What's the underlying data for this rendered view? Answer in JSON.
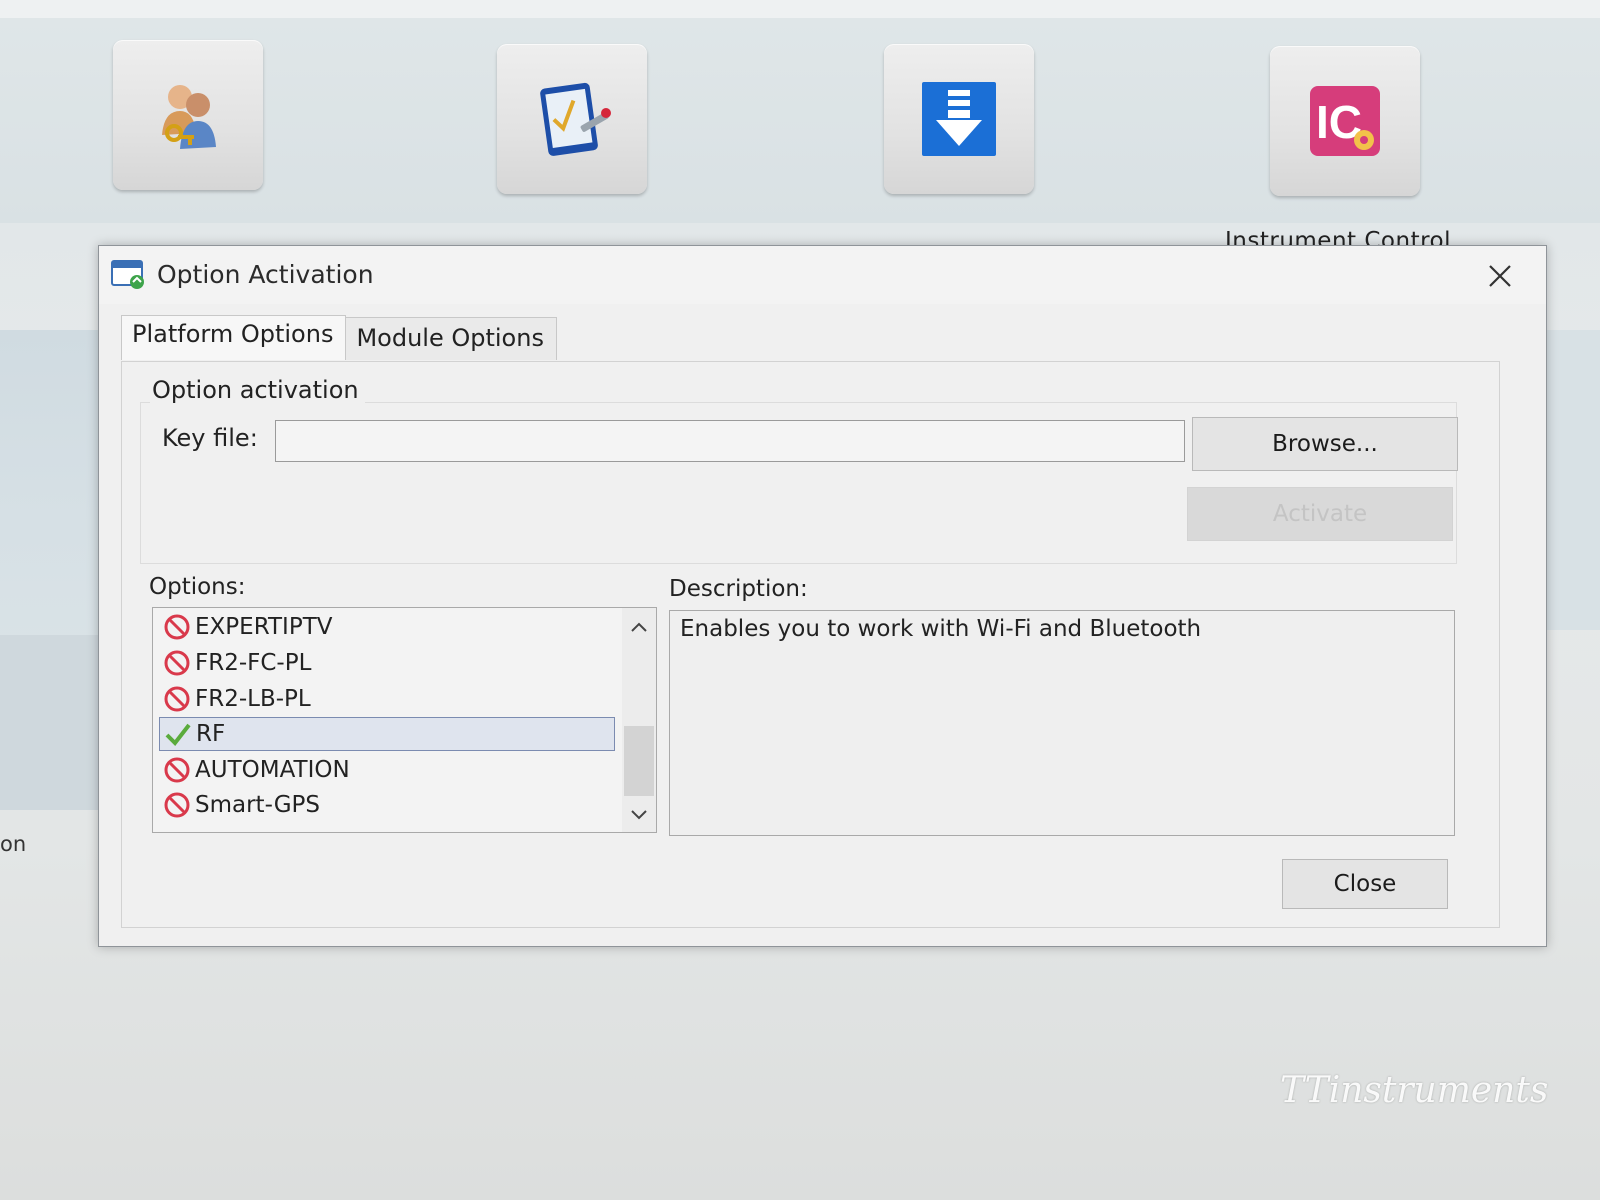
{
  "background": {
    "tiles": [
      {
        "icon": "users-key-icon"
      },
      {
        "icon": "tablet-checklist-icon"
      },
      {
        "icon": "download-arrow-icon"
      },
      {
        "icon": "ic-gear-icon"
      }
    ],
    "tile_label": "Instrument Control",
    "left_fragment": "on",
    "watermark": "TTinstruments"
  },
  "dialog": {
    "title": "Option Activation",
    "tabs": [
      {
        "label": "Platform Options",
        "active": true
      },
      {
        "label": "Module Options",
        "active": false
      }
    ],
    "group_title": "Option activation",
    "key_file_label": "Key file:",
    "key_file_value": "",
    "browse_label": "Browse...",
    "activate_label": "Activate",
    "activate_enabled": false,
    "options_label": "Options:",
    "description_label": "Description:",
    "options": [
      {
        "label": "EXPERTIPTV",
        "status": "inactive",
        "icon": "prohibited-icon"
      },
      {
        "label": "FR2-FC-PL",
        "status": "inactive",
        "icon": "prohibited-icon"
      },
      {
        "label": "FR2-LB-PL",
        "status": "inactive",
        "icon": "prohibited-icon"
      },
      {
        "label": "RF",
        "status": "active",
        "icon": "checkmark-icon",
        "selected": true
      },
      {
        "label": "AUTOMATION",
        "status": "inactive",
        "icon": "prohibited-icon"
      },
      {
        "label": "Smart-GPS",
        "status": "inactive",
        "icon": "prohibited-icon"
      }
    ],
    "description": "Enables you to work with Wi-Fi and Bluetooth",
    "close_label": "Close"
  },
  "colors": {
    "prohibited": "#d9394b",
    "checkmark": "#5aab3c",
    "selection_bg": "#dfe4ee",
    "selection_border": "#7b8bb0",
    "download_tile_blue": "#1b6fd6",
    "ic_pink": "#d63d7b"
  }
}
